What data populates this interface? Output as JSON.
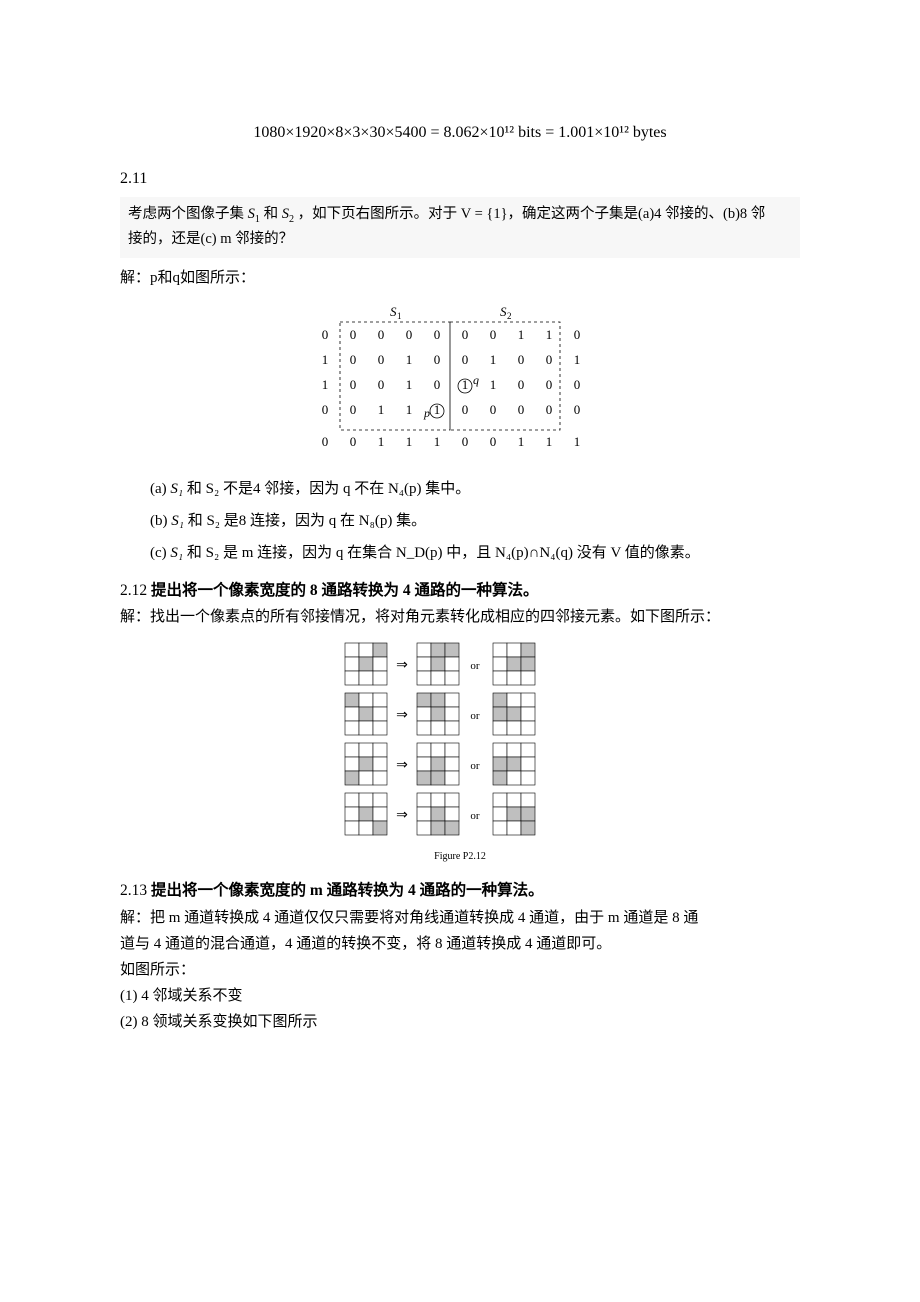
{
  "formula": "1080×1920×8×3×30×5400 = 8.062×10¹² bits = 1.001×10¹² bytes",
  "s211": {
    "num": "2.11",
    "problem_a": "考虑两个图像子集",
    "problem_b": "和",
    "problem_c": "，如下页右图所示。对于 V = {1}，确定这两个子集是(a)4 邻接的、(b)8 邻",
    "problem_d": "接的，还是(c) m 邻接的？",
    "sol_intro": "解：p和q如图所示：",
    "matrix": {
      "s1_label": "S₁",
      "s2_label": "S₂",
      "rows": [
        [
          "0",
          "0",
          "0",
          "0",
          "0",
          "0",
          "0",
          "1",
          "1",
          "0"
        ],
        [
          "1",
          "0",
          "0",
          "1",
          "0",
          "0",
          "1",
          "0",
          "0",
          "1"
        ],
        [
          "1",
          "0",
          "0",
          "1",
          "0",
          "1",
          "1",
          "0",
          "0",
          "0"
        ],
        [
          "0",
          "0",
          "1",
          "1",
          "1",
          "0",
          "0",
          "0",
          "0",
          "0"
        ],
        [
          "0",
          "0",
          "1",
          "1",
          "1",
          "0",
          "0",
          "1",
          "1",
          "1"
        ]
      ],
      "p_label": "p",
      "q_label": "q"
    },
    "ans_a_pre": "(a)  ",
    "ans_a": " 和 S₂ 不是4 邻接，因为 q 不在 N₄(p) 集中。",
    "ans_b_pre": "(b)  ",
    "ans_b": " 和 S₂ 是8 连接，因为 q 在 N₈(p) 集。",
    "ans_c_pre": "(c)  ",
    "ans_c": " 和 S₂ 是 m 连接，因为 q 在集合 N_D(p) 中，且 N₄(p)∩N₄(q) 没有 V 值的像素。",
    "s1": "S₁"
  },
  "s212": {
    "heading_num": "2.12",
    "heading_text": "提出将一个像素宽度的 8 通路转换为 4 通路的一种算法。",
    "sol": "解：找出一个像素点的所有邻接情况，将对角元素转化成相应的四邻接元素。如下图所示：",
    "caption": "Figure P2.12",
    "or": "or",
    "arrow": "⇒"
  },
  "s213": {
    "heading_num": "2.13",
    "heading_text": "提出将一个像素宽度的 m 通路转换为 4 通路的一种算法。",
    "sol1": "解：把 m 通道转换成 4 通道仅仅只需要将对角线通道转换成 4 通道，由于 m 通道是 8 通",
    "sol2": "道与 4 通道的混合通道，4 通道的转换不变，将 8 通道转换成 4 通道即可。",
    "sol3": "如图所示：",
    "item1": "(1) 4 邻域关系不变",
    "item2": "(2) 8 领域关系变换如下图所示"
  }
}
